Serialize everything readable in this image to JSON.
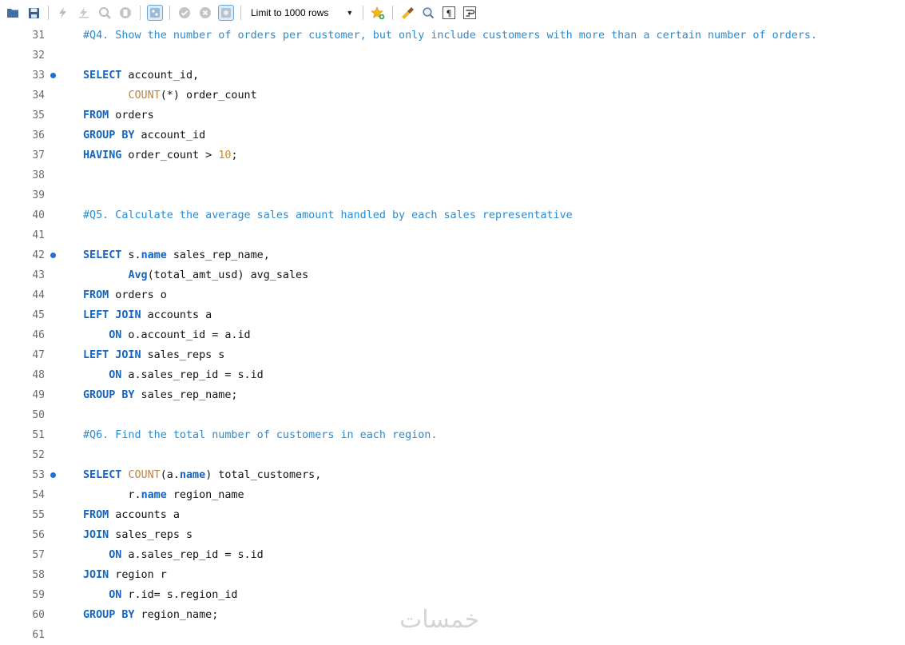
{
  "toolbar": {
    "limit_label": "Limit to 1000 rows",
    "icons": [
      "open-folder",
      "save",
      "execute",
      "execute-current",
      "explain",
      "stop",
      "toggle-continue",
      "commit",
      "rollback",
      "autocommit",
      "limit-dropdown",
      "bookmark",
      "beautify",
      "find",
      "invisible-chars",
      "wrap"
    ]
  },
  "lines": [
    {
      "n": "31",
      "marker": false,
      "text": "#Q4. Show the number of orders per customer, but only include customers with more than a certain number of orders."
    },
    {
      "n": "32",
      "marker": false,
      "text": ""
    },
    {
      "n": "33",
      "marker": true,
      "text": "SELECT account_id,"
    },
    {
      "n": "34",
      "marker": false,
      "text": "       COUNT(*) order_count"
    },
    {
      "n": "35",
      "marker": false,
      "text": "FROM orders"
    },
    {
      "n": "36",
      "marker": false,
      "text": "GROUP BY account_id"
    },
    {
      "n": "37",
      "marker": false,
      "text": "HAVING order_count > 10;"
    },
    {
      "n": "38",
      "marker": false,
      "text": ""
    },
    {
      "n": "39",
      "marker": false,
      "text": ""
    },
    {
      "n": "40",
      "marker": false,
      "text": "#Q5. Calculate the average sales amount handled by each sales representative"
    },
    {
      "n": "41",
      "marker": false,
      "text": ""
    },
    {
      "n": "42",
      "marker": true,
      "text": "SELECT s.name sales_rep_name,"
    },
    {
      "n": "43",
      "marker": false,
      "text": "       Avg(total_amt_usd) avg_sales"
    },
    {
      "n": "44",
      "marker": false,
      "text": "FROM orders o"
    },
    {
      "n": "45",
      "marker": false,
      "text": "LEFT JOIN accounts a"
    },
    {
      "n": "46",
      "marker": false,
      "text": "    ON o.account_id = a.id"
    },
    {
      "n": "47",
      "marker": false,
      "text": "LEFT JOIN sales_reps s"
    },
    {
      "n": "48",
      "marker": false,
      "text": "    ON a.sales_rep_id = s.id"
    },
    {
      "n": "49",
      "marker": false,
      "text": "GROUP BY sales_rep_name;"
    },
    {
      "n": "50",
      "marker": false,
      "text": ""
    },
    {
      "n": "51",
      "marker": false,
      "text": "#Q6. Find the total number of customers in each region."
    },
    {
      "n": "52",
      "marker": false,
      "text": ""
    },
    {
      "n": "53",
      "marker": true,
      "text": "SELECT COUNT(a.name) total_customers,"
    },
    {
      "n": "54",
      "marker": false,
      "text": "       r.name region_name"
    },
    {
      "n": "55",
      "marker": false,
      "text": "FROM accounts a"
    },
    {
      "n": "56",
      "marker": false,
      "text": "JOIN sales_reps s"
    },
    {
      "n": "57",
      "marker": false,
      "text": "    ON a.sales_rep_id = s.id"
    },
    {
      "n": "58",
      "marker": false,
      "text": "JOIN region r"
    },
    {
      "n": "59",
      "marker": false,
      "text": "    ON r.id= s.region_id"
    },
    {
      "n": "60",
      "marker": false,
      "text": "GROUP BY region_name;"
    },
    {
      "n": "61",
      "marker": false,
      "text": ""
    }
  ],
  "watermark": "خمسات",
  "colors": {
    "keyword": "#1565c0",
    "function": "#b8864b",
    "number": "#e08a00",
    "comment": "#2a8bd0",
    "marker": "#1f6fd1"
  }
}
